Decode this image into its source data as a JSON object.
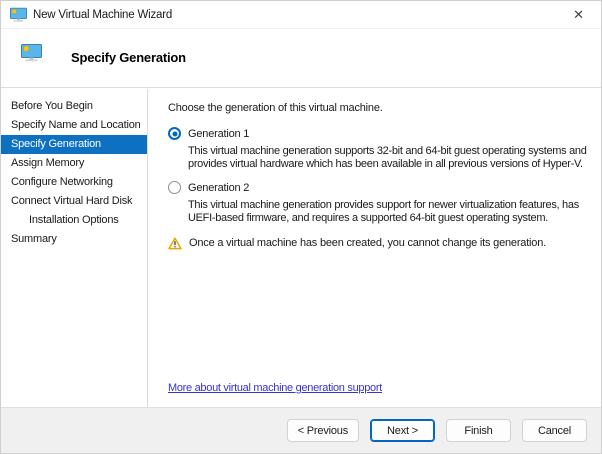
{
  "window": {
    "title": "New Virtual Machine Wizard",
    "close_glyph": "✕"
  },
  "header": {
    "title": "Specify Generation"
  },
  "sidebar": {
    "items": [
      {
        "label": "Before You Begin",
        "selected": false,
        "indent": false
      },
      {
        "label": "Specify Name and Location",
        "selected": false,
        "indent": false
      },
      {
        "label": "Specify Generation",
        "selected": true,
        "indent": false
      },
      {
        "label": "Assign Memory",
        "selected": false,
        "indent": false
      },
      {
        "label": "Configure Networking",
        "selected": false,
        "indent": false
      },
      {
        "label": "Connect Virtual Hard Disk",
        "selected": false,
        "indent": false
      },
      {
        "label": "Installation Options",
        "selected": false,
        "indent": true
      },
      {
        "label": "Summary",
        "selected": false,
        "indent": false
      }
    ]
  },
  "content": {
    "intro": "Choose the generation of this virtual machine.",
    "options": [
      {
        "label": "Generation 1",
        "selected": true,
        "description": "This virtual machine generation supports 32-bit and 64-bit guest operating systems and provides virtual hardware which has been available in all previous versions of Hyper-V."
      },
      {
        "label": "Generation 2",
        "selected": false,
        "description": "This virtual machine generation provides support for newer virtualization features, has UEFI-based firmware, and requires a supported 64-bit guest operating system."
      }
    ],
    "warning": "Once a virtual machine has been created, you cannot change its generation.",
    "link": "More about virtual machine generation support"
  },
  "footer": {
    "buttons": [
      {
        "label": "< Previous",
        "default": false
      },
      {
        "label": "Next >",
        "default": true
      },
      {
        "label": "Finish",
        "default": false
      },
      {
        "label": "Cancel",
        "default": false
      }
    ]
  },
  "colors": {
    "accent": "#0e70c1",
    "radio_accent": "#0067c0",
    "link": "#3533cd",
    "warning": "#f0a300",
    "footer_bg": "#f0f0f0"
  }
}
